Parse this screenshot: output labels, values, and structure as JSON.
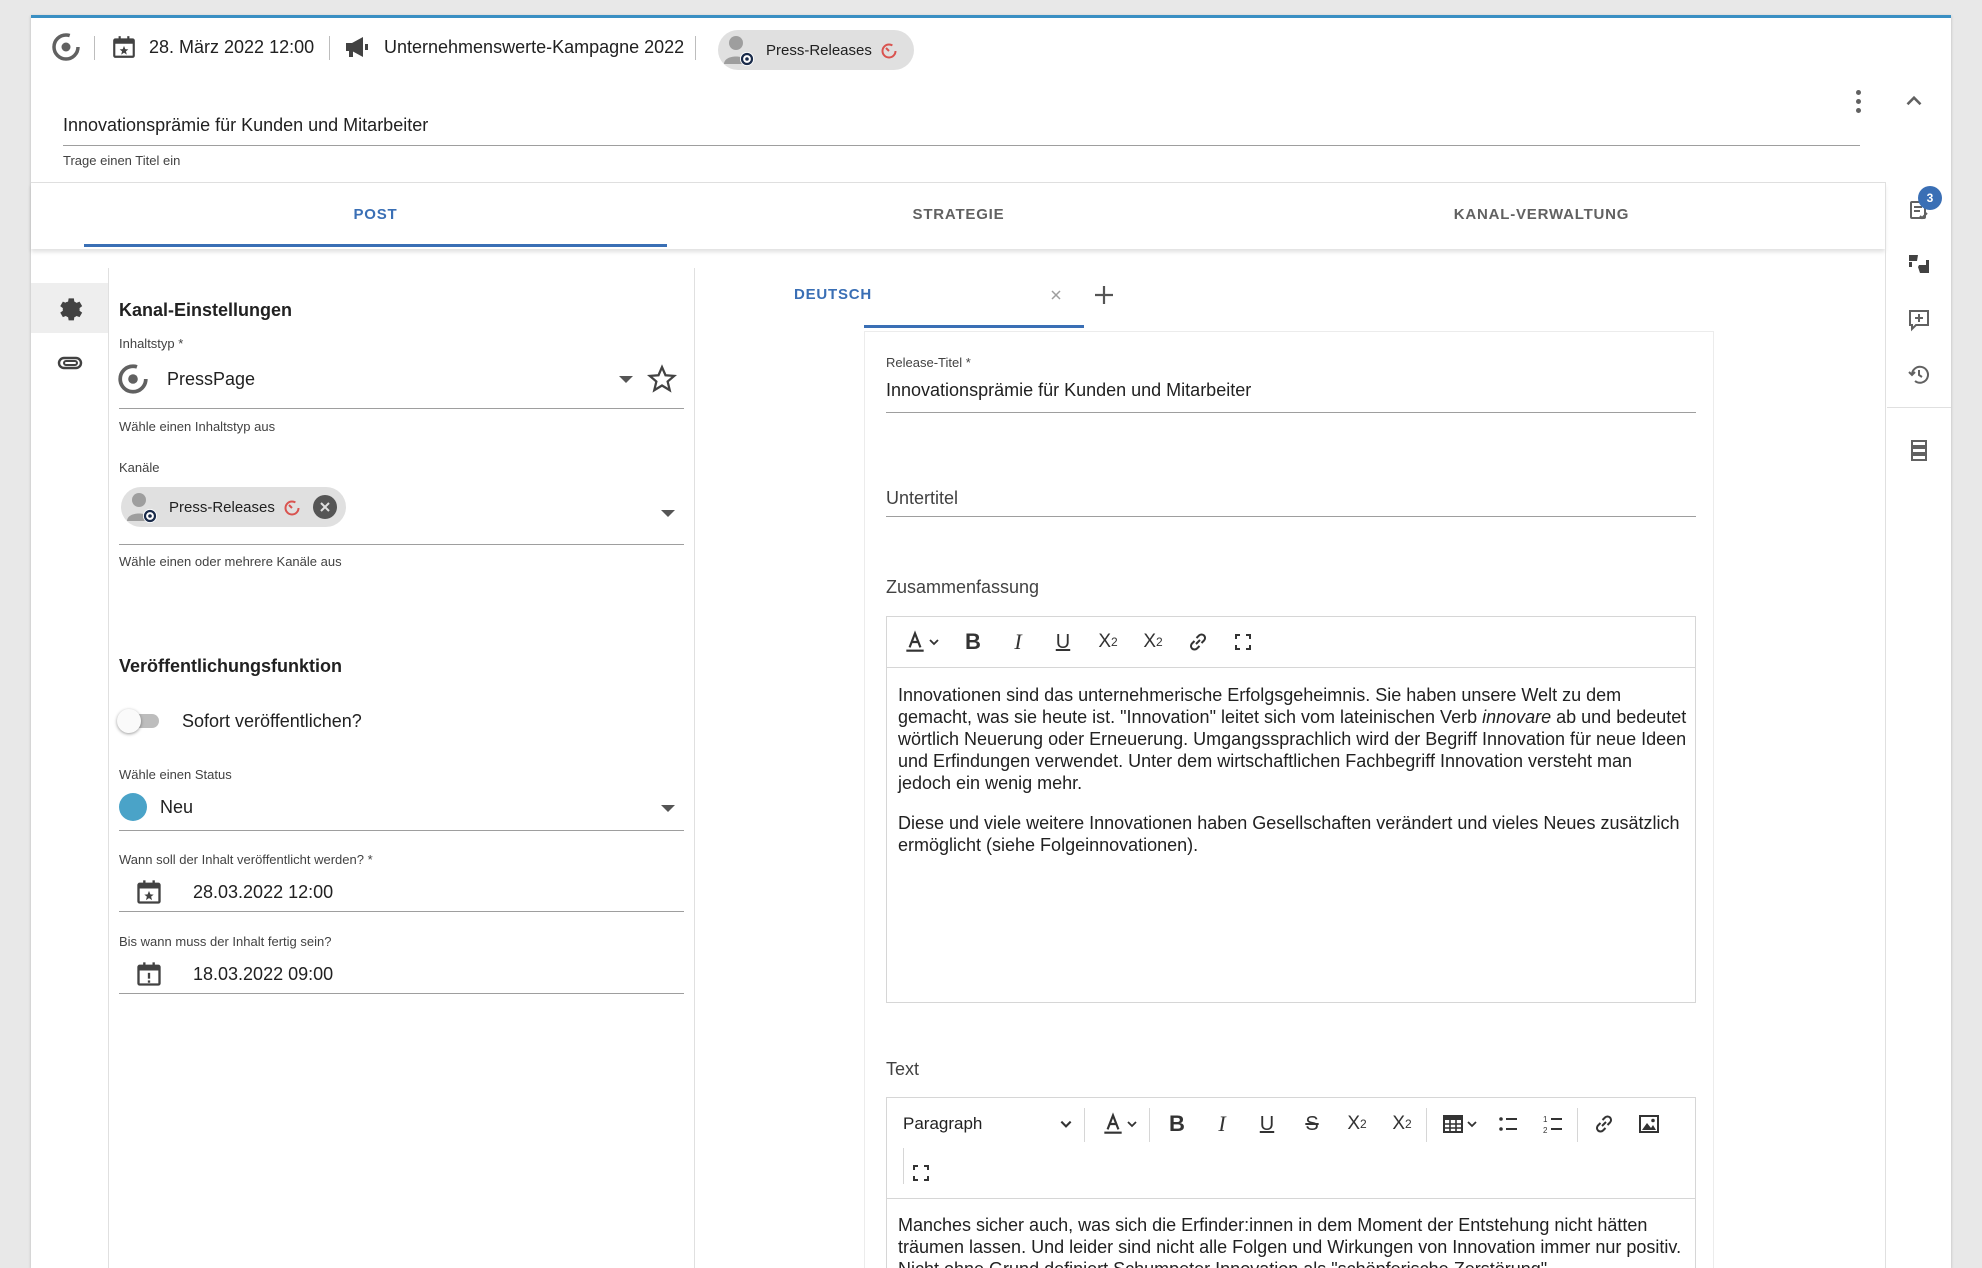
{
  "header": {
    "date": "28. März 2022 12:00",
    "campaign": "Unternehmenswerte-Kampagne 2022",
    "channel_chip": "Press-Releases",
    "title_value": "Innovationsprämie für Kunden und Mitarbeiter",
    "title_hint": "Trage einen Titel ein"
  },
  "tabs": [
    {
      "label": "POST"
    },
    {
      "label": "STRATEGIE"
    },
    {
      "label": "KANAL-VERWALTUNG"
    }
  ],
  "right_rail": {
    "badge_count": "3"
  },
  "settings": {
    "section_title": "Kanal-Einstellungen",
    "content_type_label": "Inhaltstyp *",
    "content_type_value": "PressPage",
    "content_type_hint": "Wähle einen Inhaltstyp aus",
    "channels_label": "Kanäle",
    "channel_chip": "Press-Releases",
    "channels_hint": "Wähle einen oder mehrere Kanäle aus",
    "publish_section_title": "Veröffentlichungsfunktion",
    "toggle_label": "Sofort veröffentlichen?",
    "status_label": "Wähle einen Status",
    "status_value": "Neu",
    "status_color": "#4aa3c8",
    "publish_date_label": "Wann soll der Inhalt veröffentlicht werden? *",
    "publish_date_value": "28.03.2022 12:00",
    "due_date_label": "Bis wann muss der Inhalt fertig sein?",
    "due_date_value": "18.03.2022 09:00"
  },
  "editor": {
    "language_tab": "DEUTSCH",
    "release_title_label": "Release-Titel *",
    "release_title_value": "Innovationsprämie für Kunden und Mitarbeiter",
    "subtitle_placeholder": "Untertitel",
    "summary_label": "Zusammenfassung",
    "summary_p1_a": "Innovationen sind das unternehmerische Erfolgsgeheimnis. Sie haben unsere Welt zu dem gemacht, was sie heute ist. \"Innovation\" leitet sich vom lateinischen Verb ",
    "summary_p1_em": "innovare",
    "summary_p1_b": " ab und bedeutet wörtlich Neuerung oder Erneuerung. Umgangssprachlich wird der Begriff Innovation für neue Ideen und Erfindungen verwendet. Unter dem wirtschaftlichen Fachbegriff Innovation versteht man jedoch ein wenig mehr.",
    "summary_p2": "Diese und viele weitere Innovationen haben Gesellschaften verändert und vieles Neues zusätzlich ermöglicht (siehe Folgeinnovationen).",
    "text_label": "Text",
    "paragraph_select": "Paragraph",
    "text_body": "Manches sicher auch, was sich die Erfinder:innen in dem Moment der Entstehung nicht hätten träumen lassen. Und leider sind nicht alle Folgen und Wirkungen von Innovation immer nur positiv. Nicht ohne Grund definiert Schumpeter Innovation als \"schöpferische Zerstörung\"."
  }
}
